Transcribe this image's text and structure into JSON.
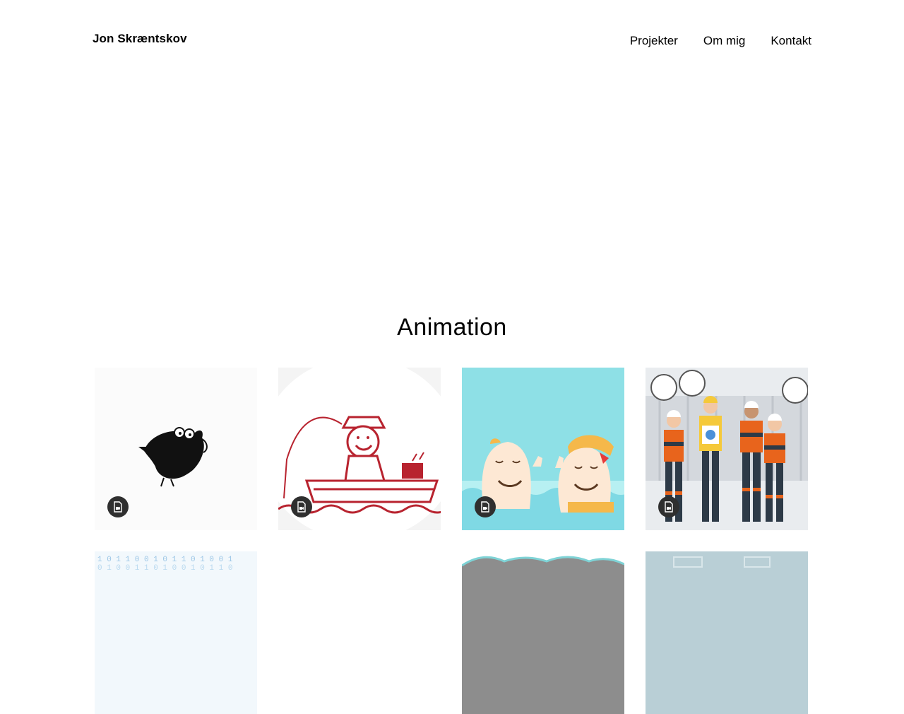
{
  "header": {
    "brand": "Jon Skræntskov",
    "nav": [
      {
        "label": "Projekter"
      },
      {
        "label": "Om mig"
      },
      {
        "label": "Kontakt"
      }
    ]
  },
  "main": {
    "section_title": "Animation",
    "projects": [
      {
        "icon": "video-file-icon"
      },
      {
        "icon": "video-file-icon"
      },
      {
        "icon": "video-file-icon"
      },
      {
        "icon": "video-file-icon"
      }
    ]
  },
  "colors": {
    "text": "#000000",
    "badge": "#2f2f2f",
    "accent_red": "#b8232f",
    "accent_orange": "#e8641c",
    "sky": "#8ee0e6"
  }
}
